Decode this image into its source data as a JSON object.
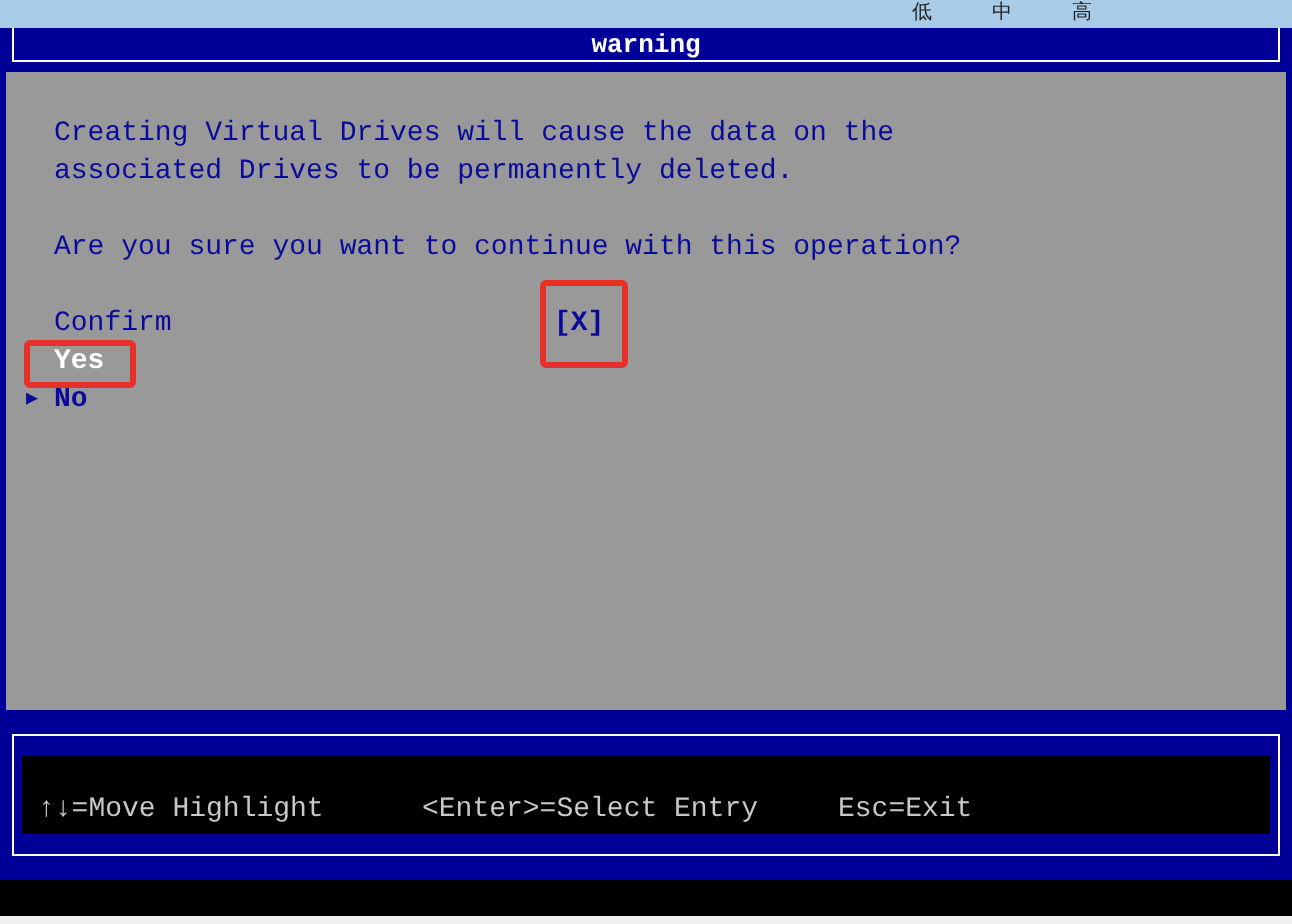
{
  "top_bar": {
    "labels": [
      "低",
      "中",
      "高"
    ]
  },
  "header": {
    "title": "warning"
  },
  "message": [
    "Creating Virtual Drives will cause the data on the",
    "associated Drives to be permanently deleted."
  ],
  "question": "Are you sure you want to continue with this operation?",
  "confirm": {
    "label": "Confirm",
    "value": "[X]"
  },
  "options": [
    {
      "label": "Yes",
      "selected": true
    },
    {
      "label": "No",
      "selected": false,
      "marker": "▶"
    }
  ],
  "footer": {
    "hints": [
      "↑↓=Move Highlight",
      "<Enter>=Select Entry",
      "Esc=Exit"
    ]
  }
}
